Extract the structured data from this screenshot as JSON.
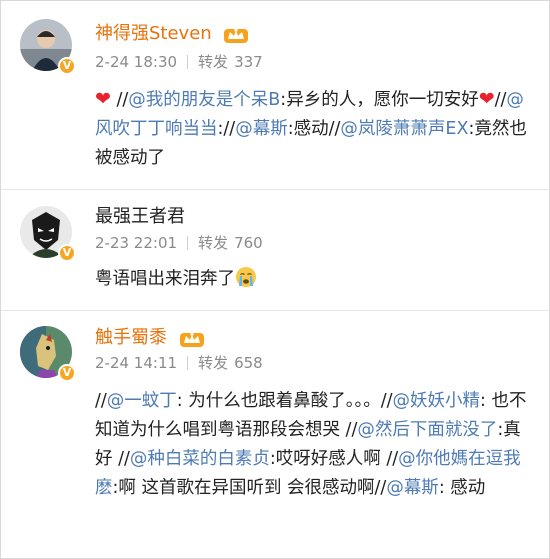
{
  "comments": [
    {
      "username": "神得强Steven",
      "date": "2-24 18:30",
      "repost_label": "转发",
      "repost_count": "337",
      "segments": [
        {
          "t": "heart",
          "v": "❤"
        },
        {
          "t": "text",
          "v": " //"
        },
        {
          "t": "mention",
          "v": "@我的朋友是个呆B"
        },
        {
          "t": "text",
          "v": ":异乡的人，愿你一切安好"
        },
        {
          "t": "heart",
          "v": "❤"
        },
        {
          "t": "text",
          "v": "//"
        },
        {
          "t": "mention",
          "v": "@风吹丁丁响当当"
        },
        {
          "t": "text",
          "v": "://"
        },
        {
          "t": "mention",
          "v": "@幕斯"
        },
        {
          "t": "text",
          "v": ":感动//"
        },
        {
          "t": "mention",
          "v": "@岚陵萧萧声EX"
        },
        {
          "t": "text",
          "v": ":竟然也被感动了"
        }
      ]
    },
    {
      "username": "最强王者君",
      "date": "2-23 22:01",
      "repost_label": "转发",
      "repost_count": "760",
      "segments": [
        {
          "t": "text",
          "v": "粤语唱出来泪奔了"
        },
        {
          "t": "cry",
          "v": "crying-emoji"
        }
      ]
    },
    {
      "username": "触手蜀黍",
      "date": "2-24 14:11",
      "repost_label": "转发",
      "repost_count": "658",
      "segments": [
        {
          "t": "text",
          "v": "//"
        },
        {
          "t": "mention",
          "v": "@一蚊丁"
        },
        {
          "t": "text",
          "v": ": 为什么也跟着鼻酸了。。。//"
        },
        {
          "t": "mention",
          "v": "@妖妖小精"
        },
        {
          "t": "text",
          "v": ": 也不知道为什么唱到粤语那段会想哭 //"
        },
        {
          "t": "mention",
          "v": "@然后下面就没了"
        },
        {
          "t": "text",
          "v": ":真好 //"
        },
        {
          "t": "mention",
          "v": "@种白菜的白素贞"
        },
        {
          "t": "text",
          "v": ":哎呀好感人啊 //"
        },
        {
          "t": "mention",
          "v": "@你他媽在逗我麽"
        },
        {
          "t": "text",
          "v": ":啊 这首歌在异国听到 会很感动啊//"
        },
        {
          "t": "mention",
          "v": "@幕斯"
        },
        {
          "t": "text",
          "v": ": 感动"
        }
      ]
    }
  ],
  "colors": {
    "vip_name": "#e8730c",
    "mention": "#4e7bb5",
    "meta": "#8a8a8a",
    "badge": "#f6a623"
  },
  "icons": {
    "crown": "vip-crown-icon",
    "verified": "verified-v-icon",
    "heart": "red-heart-emoji",
    "cry": "crying-face-emoji"
  }
}
